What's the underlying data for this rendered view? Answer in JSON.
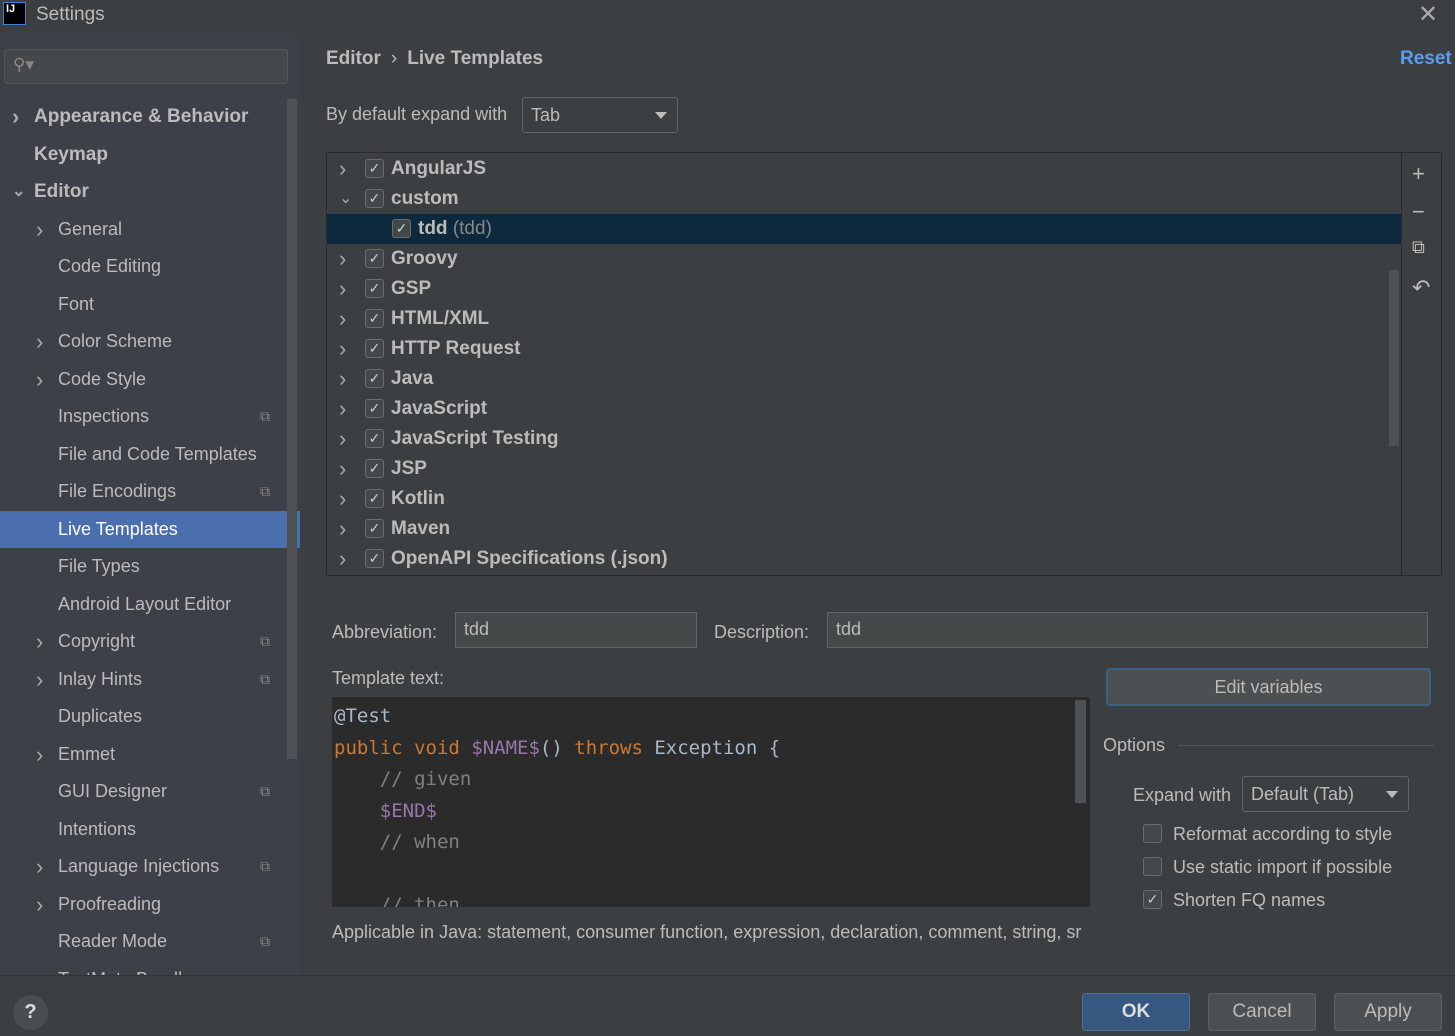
{
  "window": {
    "title": "Settings",
    "app_icon": "IJ"
  },
  "sidebar": {
    "search_placeholder": "",
    "items": [
      {
        "label": "Appearance & Behavior",
        "level": 0,
        "chevron": "right",
        "bold": true
      },
      {
        "label": "Keymap",
        "level": 0,
        "bold": true
      },
      {
        "label": "Editor",
        "level": 0,
        "chevron": "down",
        "bold": true
      },
      {
        "label": "General",
        "level": 1,
        "chevron": "right"
      },
      {
        "label": "Code Editing",
        "level": 1
      },
      {
        "label": "Font",
        "level": 1
      },
      {
        "label": "Color Scheme",
        "level": 1,
        "chevron": "right"
      },
      {
        "label": "Code Style",
        "level": 1,
        "chevron": "right"
      },
      {
        "label": "Inspections",
        "level": 1,
        "project": true
      },
      {
        "label": "File and Code Templates",
        "level": 1
      },
      {
        "label": "File Encodings",
        "level": 1,
        "project": true
      },
      {
        "label": "Live Templates",
        "level": 1,
        "selected": true
      },
      {
        "label": "File Types",
        "level": 1
      },
      {
        "label": "Android Layout Editor",
        "level": 1
      },
      {
        "label": "Copyright",
        "level": 1,
        "chevron": "right",
        "project": true
      },
      {
        "label": "Inlay Hints",
        "level": 1,
        "chevron": "right",
        "project": true
      },
      {
        "label": "Duplicates",
        "level": 1
      },
      {
        "label": "Emmet",
        "level": 1,
        "chevron": "right"
      },
      {
        "label": "GUI Designer",
        "level": 1,
        "project": true
      },
      {
        "label": "Intentions",
        "level": 1
      },
      {
        "label": "Language Injections",
        "level": 1,
        "chevron": "right",
        "project": true
      },
      {
        "label": "Proofreading",
        "level": 1,
        "chevron": "right"
      },
      {
        "label": "Reader Mode",
        "level": 1,
        "project": true
      },
      {
        "label": "TextMate Bundles",
        "level": 1
      }
    ]
  },
  "breadcrumb": {
    "parent": "Editor",
    "separator": "›",
    "current": "Live Templates"
  },
  "reset_label": "Reset",
  "expand_default": {
    "label": "By default expand with",
    "value": "Tab"
  },
  "tree": {
    "groups": [
      {
        "label": "AngularJS",
        "checked": true,
        "expanded": false
      },
      {
        "label": "custom",
        "checked": true,
        "expanded": true,
        "children": [
          {
            "label": "tdd",
            "description": "(tdd)",
            "checked": true,
            "selected": true
          }
        ]
      },
      {
        "label": "Groovy",
        "checked": true,
        "expanded": false
      },
      {
        "label": "GSP",
        "checked": true,
        "expanded": false
      },
      {
        "label": "HTML/XML",
        "checked": true,
        "expanded": false
      },
      {
        "label": "HTTP Request",
        "checked": true,
        "expanded": false
      },
      {
        "label": "Java",
        "checked": true,
        "expanded": false
      },
      {
        "label": "JavaScript",
        "checked": true,
        "expanded": false
      },
      {
        "label": "JavaScript Testing",
        "checked": true,
        "expanded": false
      },
      {
        "label": "JSP",
        "checked": true,
        "expanded": false
      },
      {
        "label": "Kotlin",
        "checked": true,
        "expanded": false
      },
      {
        "label": "Maven",
        "checked": true,
        "expanded": false
      },
      {
        "label": "OpenAPI Specifications (.json)",
        "checked": true,
        "expanded": false
      }
    ],
    "tools": [
      "plus-icon",
      "minus-icon",
      "copy-icon",
      "revert-icon"
    ]
  },
  "details": {
    "abbreviation_label": "Abbreviation:",
    "abbreviation": "tdd",
    "description_label": "Description:",
    "description": "tdd",
    "template_text_label": "Template text:",
    "template_lines": [
      [
        {
          "t": "@Test",
          "c": "plain"
        }
      ],
      [
        {
          "t": "public void ",
          "c": "kw"
        },
        {
          "t": "$NAME$",
          "c": "var"
        },
        {
          "t": "() ",
          "c": "plain"
        },
        {
          "t": "throws ",
          "c": "kw"
        },
        {
          "t": "Exception {",
          "c": "plain"
        }
      ],
      [
        {
          "t": "    // given",
          "c": "cm"
        }
      ],
      [
        {
          "t": "    ",
          "c": "plain"
        },
        {
          "t": "$END$",
          "c": "var"
        }
      ],
      [
        {
          "t": "    // when",
          "c": "cm"
        }
      ],
      [
        {
          "t": "",
          "c": "plain"
        }
      ],
      [
        {
          "t": "    // then",
          "c": "cm"
        }
      ]
    ],
    "applicable": "Applicable in Java: statement, consumer function, expression, declaration, comment, string, sr",
    "edit_variables": "Edit variables",
    "options_label": "Options",
    "expand_with_label": "Expand with",
    "expand_with_value": "Default (Tab)",
    "options": [
      {
        "label": "Reformat according to style",
        "checked": false
      },
      {
        "label": "Use static import if possible",
        "checked": false
      },
      {
        "label": "Shorten FQ names",
        "checked": true
      }
    ]
  },
  "footer": {
    "help": "?",
    "ok": "OK",
    "cancel": "Cancel",
    "apply": "Apply"
  },
  "colors": {
    "selection": "#4b6eaf",
    "tree_selection": "#0d293e",
    "link": "#589df6",
    "keyword": "#cc7832",
    "template_var": "#9876aa",
    "comment": "#808080"
  }
}
